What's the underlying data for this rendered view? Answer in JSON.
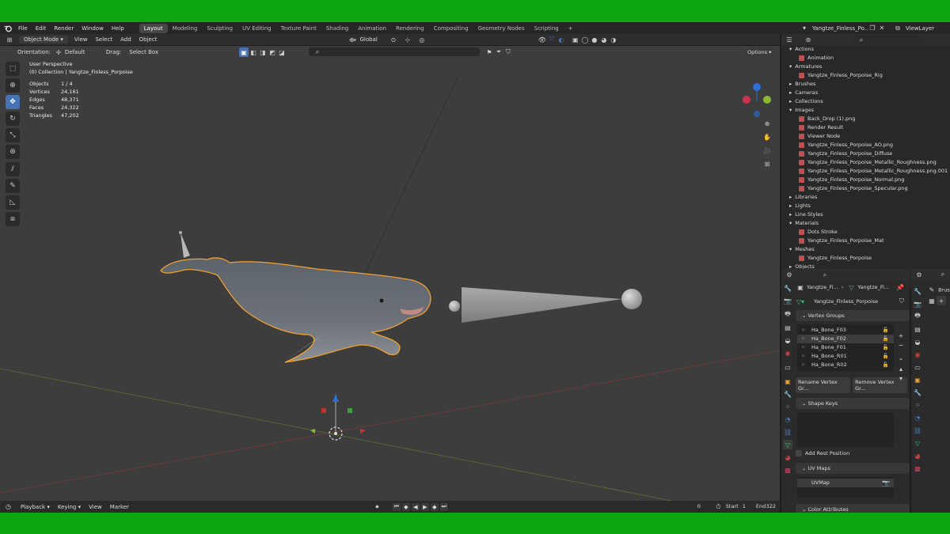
{
  "menu": {
    "items": [
      "File",
      "Edit",
      "Render",
      "Window",
      "Help"
    ],
    "workspaces": [
      "Layout",
      "Modeling",
      "Sculpting",
      "UV Editing",
      "Texture Paint",
      "Shading",
      "Animation",
      "Rendering",
      "Compositing",
      "Geometry Nodes",
      "Scripting"
    ],
    "active_workspace": "Layout",
    "add_tab": "+",
    "scene_name": "Yangtze_Finless_Po...",
    "view_layer": "ViewLayer"
  },
  "header": {
    "mode": "Object Mode",
    "view": "View",
    "select": "Select",
    "add": "Add",
    "object": "Object",
    "transform": "Global"
  },
  "tool_settings": {
    "orientation_label": "Orientation:",
    "orientation_value": "Default",
    "drag_label": "Drag:",
    "drag_value": "Select Box",
    "options": "Options"
  },
  "viewport_info": {
    "perspective": "User Perspective",
    "collection": "(0) Collection | Yangtze_Finless_Porpoise",
    "stats": [
      {
        "label": "Objects",
        "value": "1 / 4"
      },
      {
        "label": "Vertices",
        "value": "24,161"
      },
      {
        "label": "Edges",
        "value": "48,371"
      },
      {
        "label": "Faces",
        "value": "24,322"
      },
      {
        "label": "Triangles",
        "value": "47,202"
      }
    ]
  },
  "outliner": {
    "rows": [
      {
        "label": "Actions",
        "level": 0,
        "expanded": true
      },
      {
        "label": "Animation",
        "level": 1
      },
      {
        "label": "Armatures",
        "level": 0,
        "expanded": true
      },
      {
        "label": "Yangtze_Finless_Porpoise_Rig",
        "level": 1
      },
      {
        "label": "Brushes",
        "level": 0
      },
      {
        "label": "Cameras",
        "level": 0
      },
      {
        "label": "Collections",
        "level": 0
      },
      {
        "label": "Images",
        "level": 0,
        "expanded": true
      },
      {
        "label": "Back_Drop (1).png",
        "level": 1
      },
      {
        "label": "Render Result",
        "level": 1
      },
      {
        "label": "Viewer Node",
        "level": 1
      },
      {
        "label": "Yangtze_Finless_Porpoise_AO.png",
        "level": 1
      },
      {
        "label": "Yangtze_Finless_Porpoise_Diffuse",
        "level": 1
      },
      {
        "label": "Yangtze_Finless_Porpoise_Metallic_Roughness.png",
        "level": 1
      },
      {
        "label": "Yangtze_Finless_Porpoise_Metallic_Roughness.png.001",
        "level": 1
      },
      {
        "label": "Yangtze_Finless_Porpoise_Normal.png",
        "level": 1
      },
      {
        "label": "Yangtze_Finless_Porpoise_Specular.png",
        "level": 1
      },
      {
        "label": "Libraries",
        "level": 0
      },
      {
        "label": "Lights",
        "level": 0
      },
      {
        "label": "Line Styles",
        "level": 0
      },
      {
        "label": "Materials",
        "level": 0,
        "expanded": true
      },
      {
        "label": "Dots Stroke",
        "level": 1
      },
      {
        "label": "Yangtze_Finless_Porpoise_Mat",
        "level": 1
      },
      {
        "label": "Meshes",
        "level": 0,
        "expanded": true
      },
      {
        "label": "Yangtze_Finless_Porpoise",
        "level": 1
      },
      {
        "label": "Objects",
        "level": 0
      }
    ]
  },
  "properties": {
    "breadcrumb_a": "Yangtze_Fi...",
    "breadcrumb_b": "Yangtze_Fi...",
    "mesh_name": "Yangtze_Finless_Porpoise",
    "vertex_groups_title": "Vertex Groups",
    "vertex_groups": [
      "Ha_Bone_F03",
      "Ha_Bone_F02",
      "Ha_Bone_F01",
      "Ha_Bone_R01",
      "Ha_Bone_R02"
    ],
    "selected_vertex_group": "Ha_Bone_F02",
    "rename_btn": "Rename Vertex Gr...",
    "remove_btn": "Remove Vertex Gr...",
    "shape_keys_title": "Shape Keys",
    "add_rest_position": "Add Rest Position",
    "uv_maps_title": "UV Maps",
    "uv_map": "UVMap",
    "color_attributes_title": "Color Attributes",
    "side_label": "Brus"
  },
  "timeline": {
    "playback": "Playback",
    "keying": "Keying",
    "view": "View",
    "marker": "Marker",
    "current_frame": "0",
    "start_label": "Start",
    "start": "1",
    "end_label": "End",
    "end": "322"
  },
  "colors": {
    "accent": "#4772b3",
    "selection_outline": "#f0a030",
    "viewport_bg": "#3d3d3d",
    "frame_border": "#0ea60e"
  }
}
